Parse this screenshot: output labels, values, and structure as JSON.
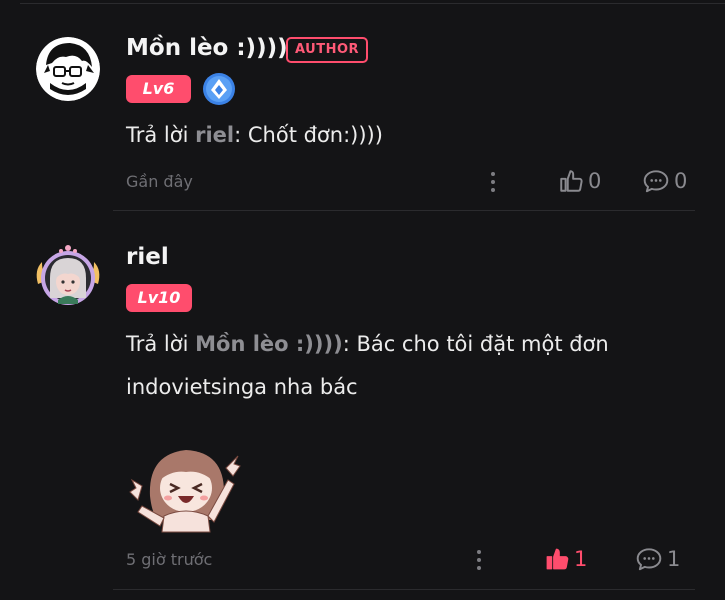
{
  "comments": [
    {
      "username": "Mồn lèo :))))",
      "author_badge": "AUTHOR",
      "level": "Lv6",
      "reply_prefix": "Trả lời ",
      "reply_to": "riel",
      "body": ": Chốt đơn:))))",
      "time": "Gần đây",
      "likes": "0",
      "replies": "0",
      "liked": false
    },
    {
      "username": "riel",
      "level": "Lv10",
      "reply_prefix": "Trả lời ",
      "reply_to": "Mồn lèo :))))",
      "body": ": Bác cho tôi đặt một đơn indovietsinga nha bác",
      "time": "5 giờ trước",
      "likes": "1",
      "replies": "1",
      "liked": true
    }
  ],
  "colors": {
    "background": "#141416",
    "accent": "#ff4d6d",
    "muted": "#6f6f74",
    "vip_badge": "#3b82e6"
  },
  "icons": {
    "like": "thumbs-up-icon",
    "reply": "comment-bubble-icon",
    "more": "more-vertical-icon",
    "vip": "vip-shield-icon"
  }
}
